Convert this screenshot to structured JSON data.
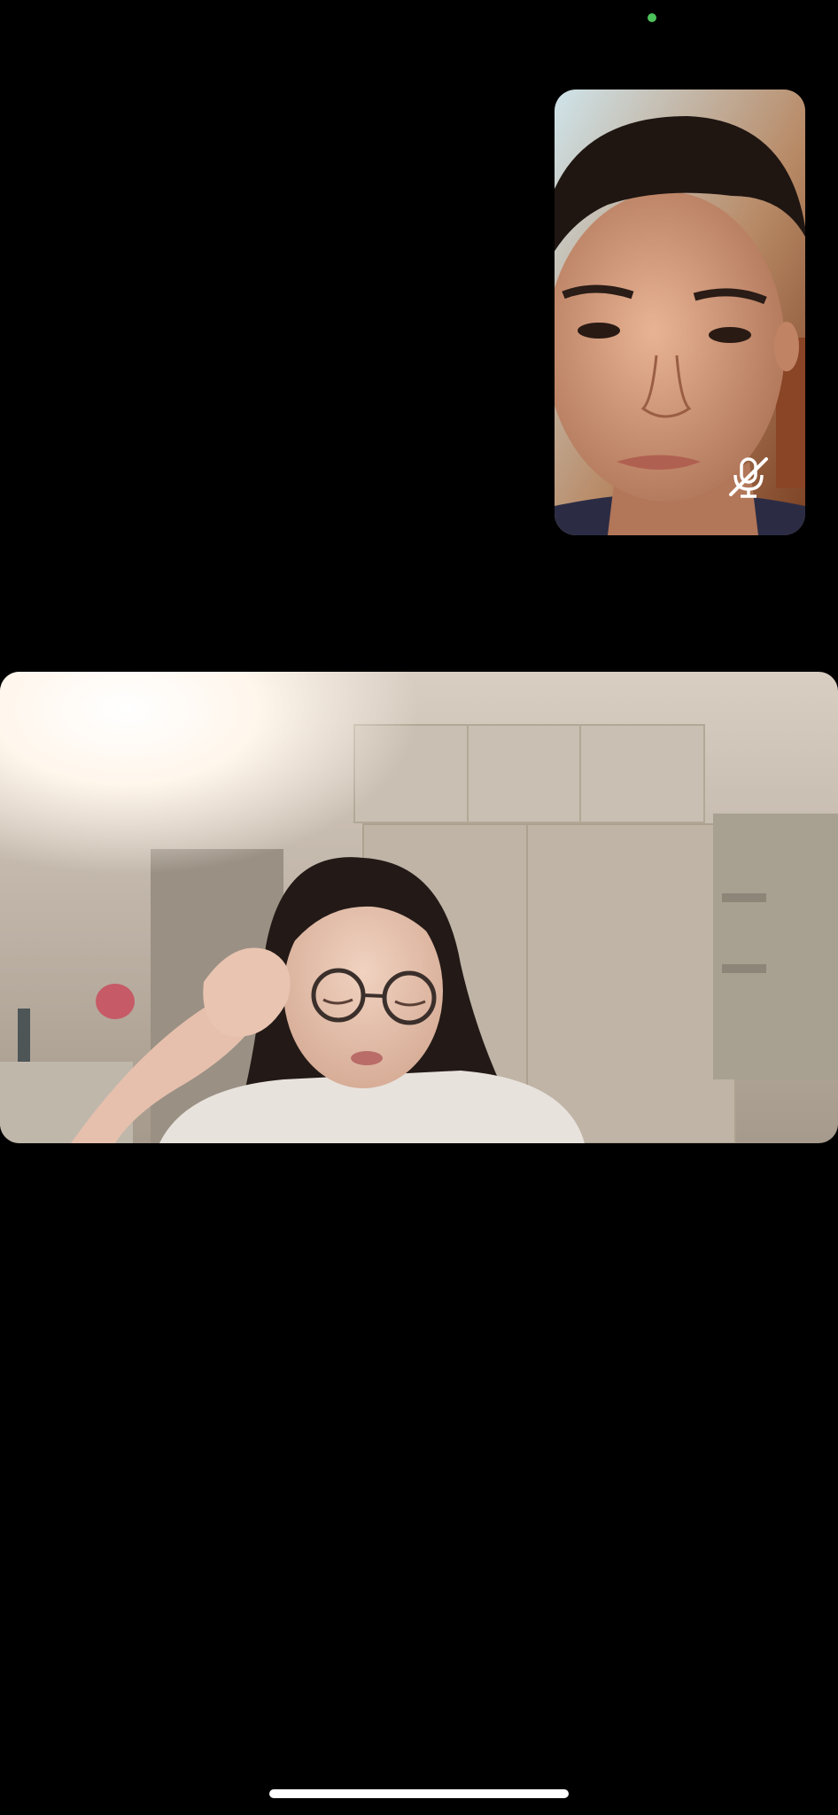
{
  "status": {
    "camera_in_use_color": "#4cc25a"
  },
  "self_view": {
    "mic_state": "muted",
    "mic_icon": "mic-slash-icon"
  },
  "remote_view": {
    "state": "video-on"
  },
  "home_indicator": {
    "color": "#ffffff"
  }
}
